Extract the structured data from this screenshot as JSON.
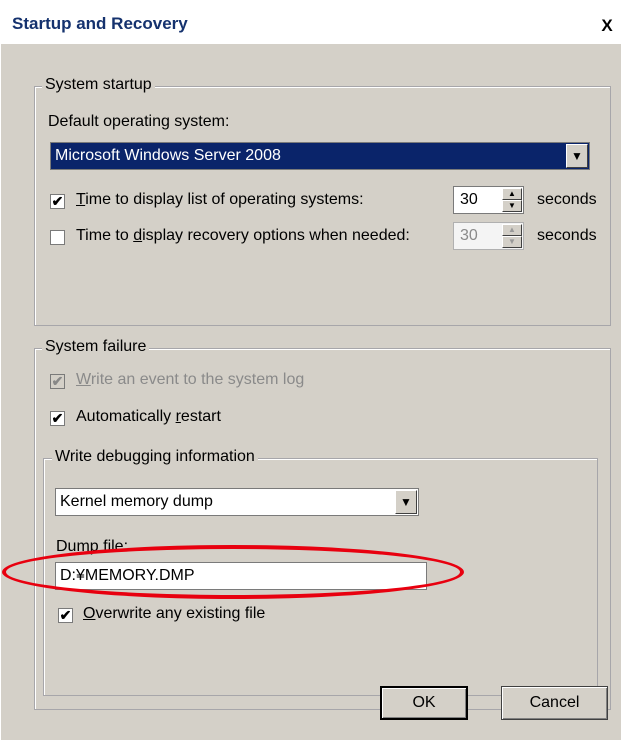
{
  "window": {
    "title": "Startup and Recovery",
    "close_glyph": "X"
  },
  "system_startup": {
    "legend": "System startup",
    "default_os_label": "Default operating system:",
    "default_os_value": "Microsoft Windows Server 2008",
    "time_list": {
      "checked": true,
      "label_u": "T",
      "label_rest": "ime to display list of operating systems:",
      "value": "30",
      "unit": "seconds"
    },
    "time_recovery": {
      "checked": false,
      "label_pre": "Time to ",
      "label_u": "d",
      "label_rest": "isplay recovery options when needed:",
      "value": "30",
      "unit": "seconds"
    }
  },
  "system_failure": {
    "legend": "System failure",
    "write_event": {
      "checked": true,
      "disabled": true,
      "label_u": "W",
      "label_rest": "rite an event to the system log"
    },
    "auto_restart": {
      "checked": true,
      "label_pre": "Automatically ",
      "label_u": "r",
      "label_rest": "estart"
    },
    "debug": {
      "legend": "Write debugging information",
      "type_value": "Kernel memory dump",
      "dump_file_label": "Dump file:",
      "dump_file_value": "D:¥MEMORY.DMP",
      "overwrite": {
        "checked": true,
        "label_u": "O",
        "label_rest": "verwrite any existing file"
      }
    }
  },
  "buttons": {
    "ok": "OK",
    "cancel": "Cancel"
  },
  "colors": {
    "highlight": "#e8000f",
    "title": "#15326e",
    "selection": "#0a246a"
  }
}
